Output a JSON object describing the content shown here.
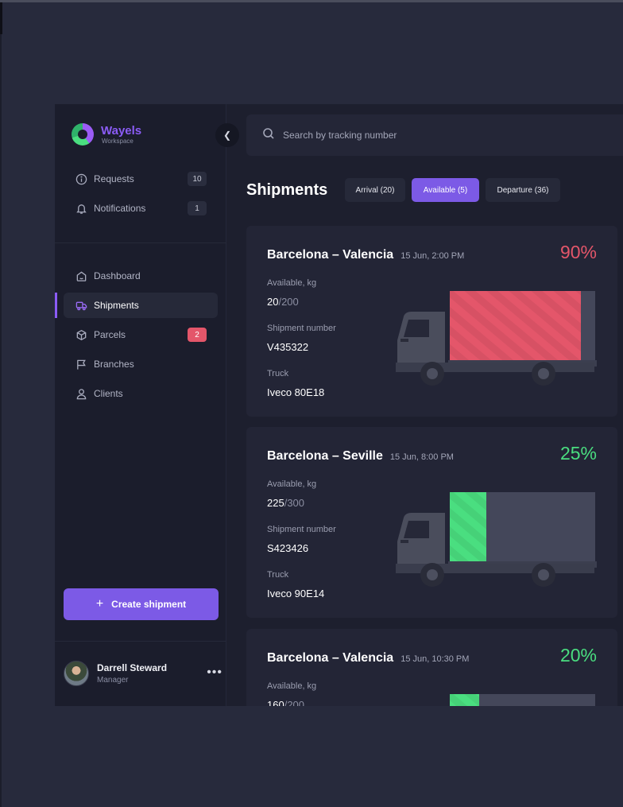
{
  "brand": {
    "name": "Wayels",
    "subtitle": "Workspace"
  },
  "search": {
    "placeholder": "Search by tracking number"
  },
  "sidebar": {
    "top_items": [
      {
        "label": "Requests",
        "icon": "info-icon",
        "count": "10"
      },
      {
        "label": "Notifications",
        "icon": "bell-icon",
        "count": "1"
      }
    ],
    "nav_items": [
      {
        "label": "Dashboard",
        "icon": "home-icon"
      },
      {
        "label": "Shipments",
        "icon": "truck-icon",
        "active": true
      },
      {
        "label": "Parcels",
        "icon": "box-icon",
        "count": "2"
      },
      {
        "label": "Branches",
        "icon": "flag-icon"
      },
      {
        "label": "Clients",
        "icon": "user-icon"
      }
    ],
    "create_label": "Create shipment",
    "user": {
      "name": "Darrell Steward",
      "role": "Manager"
    }
  },
  "main": {
    "title": "Shipments",
    "tabs": [
      {
        "label": "Arrival (20)",
        "active": false
      },
      {
        "label": "Available (5)",
        "active": true
      },
      {
        "label": "Departure (36)",
        "active": false
      }
    ],
    "labels": {
      "available": "Available, kg",
      "number": "Shipment number",
      "truck": "Truck"
    },
    "shipments": [
      {
        "route": "Barcelona – Valencia",
        "date": "15 Jun, 2:00 PM",
        "percent": "90%",
        "fill": 0.9,
        "color": "#e4566a",
        "available": "20",
        "capacity": "/200",
        "number": "V435322",
        "truck": "Iveco 80E18"
      },
      {
        "route": "Barcelona – Seville",
        "date": "15 Jun, 8:00 PM",
        "percent": "25%",
        "fill": 0.25,
        "color": "#4ade80",
        "available": "225",
        "capacity": "/300",
        "number": "S423426",
        "truck": "Iveco 90E14"
      },
      {
        "route": "Barcelona – Valencia",
        "date": "15 Jun, 10:30 PM",
        "percent": "20%",
        "fill": 0.2,
        "color": "#4ade80",
        "available": "160",
        "capacity": "/200",
        "number": "",
        "truck": ""
      }
    ]
  },
  "colors": {
    "accent": "#7c5ae6",
    "danger": "#e4566a",
    "success": "#4ade80"
  }
}
